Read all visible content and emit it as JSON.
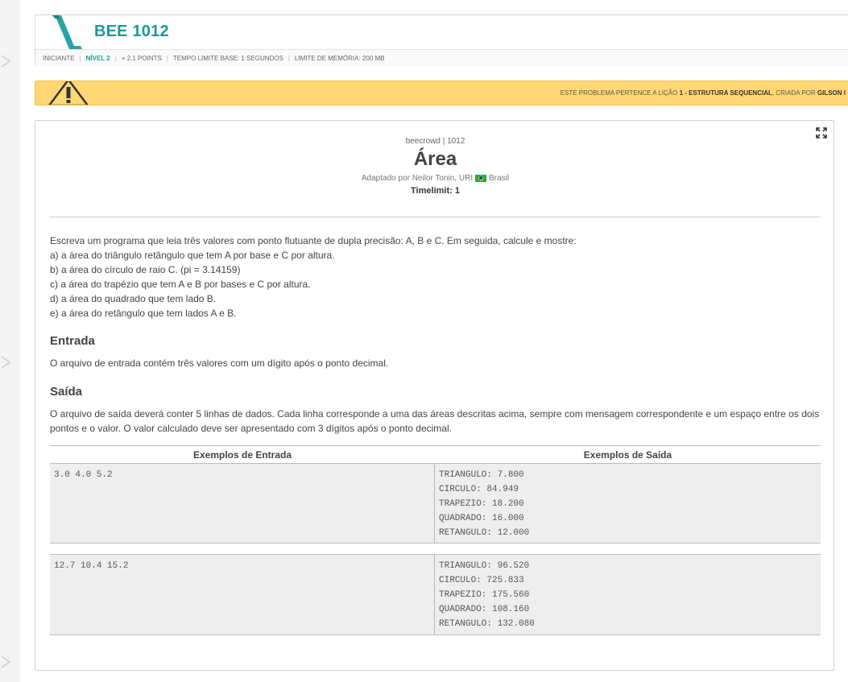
{
  "header": {
    "problem_code": "BEE 1012",
    "meta": {
      "category": "INICIANTE",
      "level": "NÍVEL 2",
      "points": "+ 2.1 POINTS",
      "time_limit": "TEMPO LIMITE BASE: 1 SEGUNDOS",
      "memory_limit": "LIMITE DE MEMÓRIA: 200 MB"
    }
  },
  "warning": {
    "prefix": "ESTE PROBLEMA PERTENCE A LIÇÃO ",
    "lesson": "1 - ESTRUTURA SEQUENCIAL",
    "middle": ", CRIADA POR ",
    "author": "GILSON I"
  },
  "problem": {
    "breadcrumb": "beecrowd | 1012",
    "title": "Área",
    "adapted_by": "Adaptado por Neilor Tonin, URI",
    "country": "Brasil",
    "timelimit": "Timelimit: 1",
    "description": [
      "Escreva um programa que leia três valores com ponto flutuante de dupla precisão: A, B e C. Em seguida, calcule e mostre:",
      "a) a área do triângulo retângulo que tem A por base e C por altura.",
      "b) a área do círculo de raio C. (pi = 3.14159)",
      "c) a área do trapézio que tem A e B por bases e C por altura.",
      "d) a área do quadrado que tem lado B.",
      "e) a área do retângulo que tem lados A e B."
    ],
    "input_heading": "Entrada",
    "input_text": "O arquivo de entrada contém três valores com um dígito após o ponto decimal.",
    "output_heading": "Saída",
    "output_text": "O arquivo de saída deverá conter 5 linhas de dados. Cada linha corresponde a uma das áreas descritas acima, sempre com mensagem correspondente e um espaço entre os dois pontos e o valor. O valor calculado deve ser apresentado com 3 dígitos após o ponto decimal."
  },
  "examples": {
    "input_header": "Exemplos de Entrada",
    "output_header": "Exemplos de Saída",
    "rows": [
      {
        "input": "3.0 4.0 5.2",
        "output": "TRIANGULO: 7.800\nCIRCULO: 84.949\nTRAPEZIO: 18.200\nQUADRADO: 16.000\nRETANGULO: 12.000"
      },
      {
        "input": "12.7 10.4 15.2",
        "output": "TRIANGULO: 96.520\nCIRCULO: 725.833\nTRAPEZIO: 175.560\nQUADRADO: 108.160\nRETANGULO: 132.080"
      }
    ]
  },
  "icons": {
    "logo": "beecrowd-logo",
    "warning": "warning-triangle-icon",
    "expand": "expand-fullscreen-icon",
    "flag": "brazil-flag-icon"
  },
  "colors": {
    "accent": "#1e9a9a",
    "warning_bg": "#ffd875",
    "example_bg": "#eeeeee"
  }
}
